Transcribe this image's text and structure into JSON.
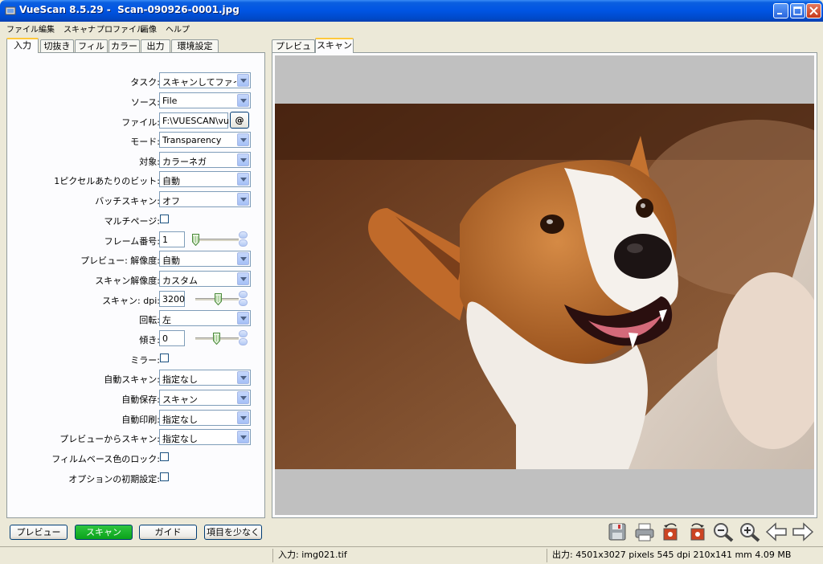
{
  "window": {
    "title": "VueScan 8.5.29 -  Scan-090926-0001.jpg"
  },
  "menu": [
    "ファイル",
    "編集",
    "スキャナ",
    "プロファイル",
    "画像",
    "ヘルプ"
  ],
  "left_tabs": [
    "入力",
    "切抜き",
    "フィルタ",
    "カラー",
    "出力",
    "環境設定"
  ],
  "right_tabs": [
    "プレビュー",
    "スキャン"
  ],
  "form": {
    "task": {
      "label": "タスク:",
      "value": "スキャンしてファイル("
    },
    "source": {
      "label": "ソース:",
      "value": "File"
    },
    "file": {
      "label": "ファイル:",
      "value": "F:\\VUESCAN\\vu",
      "button": "@"
    },
    "mode": {
      "label": "モード:",
      "value": "Transparency"
    },
    "media": {
      "label": "対象:",
      "value": "カラーネガ"
    },
    "bits": {
      "label": "1ピクセルあたりのビット:",
      "value": "自動"
    },
    "batch": {
      "label": "バッチスキャン:",
      "value": "オフ"
    },
    "multipage": {
      "label": "マルチページ:"
    },
    "frame": {
      "label": "フレーム番号:",
      "value": "1"
    },
    "preview_res": {
      "label": "プレビュー: 解像度:",
      "value": "自動"
    },
    "scan_res": {
      "label": "スキャン解像度:",
      "value": "カスタム"
    },
    "dpi": {
      "label": "スキャン: dpi:",
      "value": "3200"
    },
    "rotation": {
      "label": "回転:",
      "value": "左"
    },
    "skew": {
      "label": "傾き:",
      "value": "0"
    },
    "mirror": {
      "label": "ミラー:"
    },
    "auto_scan": {
      "label": "自動スキャン:",
      "value": "指定なし"
    },
    "auto_save": {
      "label": "自動保存:",
      "value": "スキャン"
    },
    "auto_print": {
      "label": "自動印刷:",
      "value": "指定なし"
    },
    "scan_from_preview": {
      "label": "プレビューからスキャン:",
      "value": "指定なし"
    },
    "lock_film_base": {
      "label": "フィルムベース色のロック:"
    },
    "default_options": {
      "label": "オプションの初期設定:"
    }
  },
  "buttons": {
    "preview": "プレビュー",
    "scan": "スキャン",
    "guide": "ガイド",
    "fewer": "項目を少なく"
  },
  "status": {
    "input": "入力: img021.tif",
    "output": "出力: 4501x3027 pixels 545 dpi 210x141 mm 4.09 MB"
  },
  "colors": {
    "titlebar": "#0054e3",
    "scan_button": "#0aa31b",
    "tab_highlight": "#ffc83c"
  }
}
